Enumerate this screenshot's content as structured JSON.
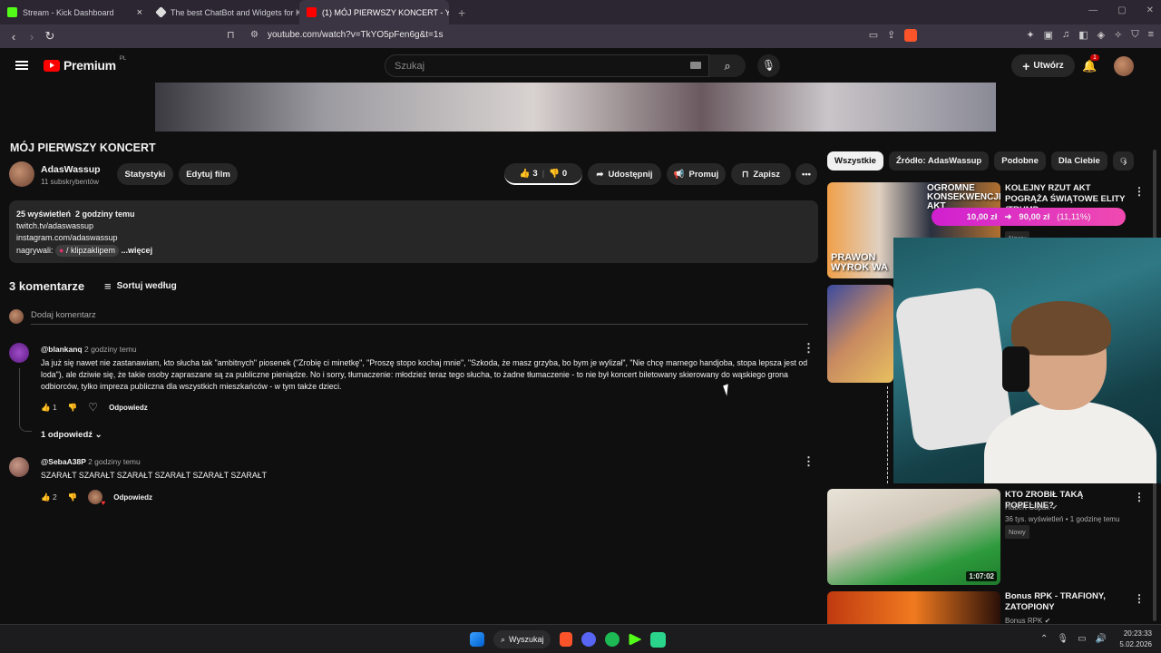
{
  "browser": {
    "tabs": [
      {
        "label": "Stream - Kick Dashboard",
        "color": "#53fc18"
      },
      {
        "label": "The best ChatBot and Widgets for Ki",
        "color": "#dddddd"
      },
      {
        "label": "(1) MÓJ PIERWSZY KONCERT - Y",
        "color": "#ff0000"
      }
    ],
    "url": "youtube.com/watch?v=TkYO5pFen6g&t=1s"
  },
  "header": {
    "logo": "Premium",
    "logo_country": "PL",
    "search_placeholder": "Szukaj",
    "create_label": "Utwórz",
    "notifications": "1"
  },
  "video": {
    "title": "MÓJ PIERWSZY KONCERT",
    "channel": "AdasWassup",
    "subs": "11 subskrybentów",
    "stats_btn": "Statystyki",
    "edit_btn": "Edytuj film",
    "likes": "3",
    "dislikes": "0",
    "share": "Udostępnij",
    "promote": "Promuj",
    "save": "Zapisz"
  },
  "description": {
    "views": "25 wyświetleń",
    "time": "2 godziny temu",
    "line1": "twitch.tv/adaswassup",
    "line2": "instagram.com/adaswassup",
    "line3_prefix": "nagrywali:",
    "line3_tag": "/ klipzaklipem",
    "more": "...więcej"
  },
  "comments": {
    "count": "3 komentarze",
    "sort": "Sortuj według",
    "add_placeholder": "Dodaj komentarz",
    "items": [
      {
        "user": "@blankanq",
        "time": "2 godziny temu",
        "text": "Ja już się nawet nie zastanawiam, kto słucha tak \"ambitnych\" piosenek (\"Zrobię ci minetkę\", \"Proszę stopo kochaj mnie\", \"Szkoda, że masz grzyba, bo bym je wylizał\", \"Nie chcę marnego handjoba, stopa lepsza jest od loda\"), ale dziwie się, że takie osoby zapraszane są za publiczne pieniądze. No i sorry, tłumaczenie: młodzież teraz tego słucha, to żadne tłumaczenie - to nie był koncert biletowany skierowany do wąskiego grona odbiorców, tylko impreza publiczna dla wszystkich mieszkańców - w tym także dzieci.",
        "likes": "1",
        "reply": "Odpowiedz",
        "replies": "1 odpowiedź"
      },
      {
        "user": "@SebaA38P",
        "time": "2 godziny temu",
        "text": "SZARAŁT SZARAŁT SZARAŁT SZARAŁT SZARAŁT SZARAŁT",
        "likes": "2",
        "reply": "Odpowiedz"
      }
    ]
  },
  "sidebar": {
    "chips": [
      "Wszystkie",
      "Źródło: AdasWassup",
      "Podobne",
      "Dla Ciebie",
      "O"
    ],
    "videos": [
      {
        "title": "KOLEJNY RZUT AKT POGRĄŻA ŚWIĄTOWE ELITY (TRUMP, ...",
        "price_old": "10,00 zł",
        "price_new": "90,00 zł",
        "percent": "(11,11%)",
        "badge": "Nowy",
        "thumb_text": "OGROMNE KONSEKWENCJE AKT",
        "thumb_text2": "PRAWON WYROK WA"
      },
      {
        "title": "KTO ZROBIŁ TAKĄ POPELINE?",
        "channel": "Hubert Cupak",
        "meta": "36 tys. wyświetleń • 1 godzinę temu",
        "badge": "Nowy",
        "duration": "1:07:02"
      },
      {
        "title": "Bonus RPK - TRAFIONY, ZATOPIONY",
        "channel": "Bonus RPK"
      }
    ]
  },
  "taskbar": {
    "search": "Wyszukaj",
    "time": "20:23:33",
    "date": "5.02.2026"
  }
}
